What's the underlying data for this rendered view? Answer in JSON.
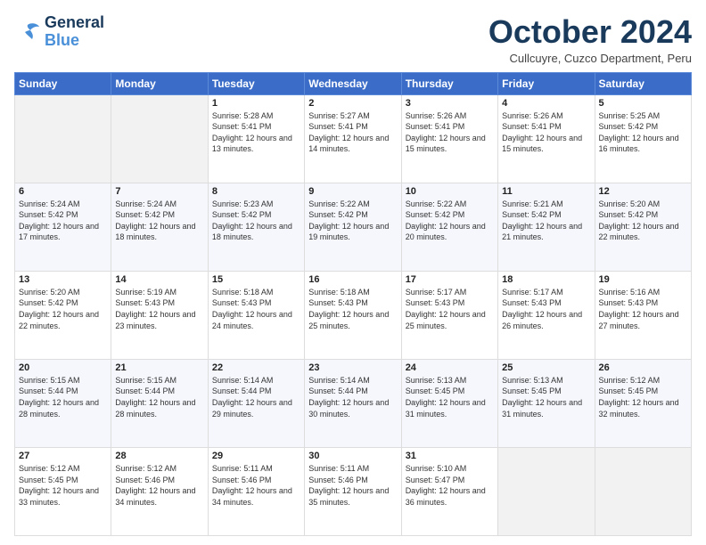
{
  "logo": {
    "line1": "General",
    "line2": "Blue"
  },
  "title": "October 2024",
  "location": "Cullcuyre, Cuzco Department, Peru",
  "days_header": [
    "Sunday",
    "Monday",
    "Tuesday",
    "Wednesday",
    "Thursday",
    "Friday",
    "Saturday"
  ],
  "weeks": [
    [
      {
        "day": "",
        "info": ""
      },
      {
        "day": "",
        "info": ""
      },
      {
        "day": "1",
        "info": "Sunrise: 5:28 AM\nSunset: 5:41 PM\nDaylight: 12 hours and 13 minutes."
      },
      {
        "day": "2",
        "info": "Sunrise: 5:27 AM\nSunset: 5:41 PM\nDaylight: 12 hours and 14 minutes."
      },
      {
        "day": "3",
        "info": "Sunrise: 5:26 AM\nSunset: 5:41 PM\nDaylight: 12 hours and 15 minutes."
      },
      {
        "day": "4",
        "info": "Sunrise: 5:26 AM\nSunset: 5:41 PM\nDaylight: 12 hours and 15 minutes."
      },
      {
        "day": "5",
        "info": "Sunrise: 5:25 AM\nSunset: 5:42 PM\nDaylight: 12 hours and 16 minutes."
      }
    ],
    [
      {
        "day": "6",
        "info": "Sunrise: 5:24 AM\nSunset: 5:42 PM\nDaylight: 12 hours and 17 minutes."
      },
      {
        "day": "7",
        "info": "Sunrise: 5:24 AM\nSunset: 5:42 PM\nDaylight: 12 hours and 18 minutes."
      },
      {
        "day": "8",
        "info": "Sunrise: 5:23 AM\nSunset: 5:42 PM\nDaylight: 12 hours and 18 minutes."
      },
      {
        "day": "9",
        "info": "Sunrise: 5:22 AM\nSunset: 5:42 PM\nDaylight: 12 hours and 19 minutes."
      },
      {
        "day": "10",
        "info": "Sunrise: 5:22 AM\nSunset: 5:42 PM\nDaylight: 12 hours and 20 minutes."
      },
      {
        "day": "11",
        "info": "Sunrise: 5:21 AM\nSunset: 5:42 PM\nDaylight: 12 hours and 21 minutes."
      },
      {
        "day": "12",
        "info": "Sunrise: 5:20 AM\nSunset: 5:42 PM\nDaylight: 12 hours and 22 minutes."
      }
    ],
    [
      {
        "day": "13",
        "info": "Sunrise: 5:20 AM\nSunset: 5:42 PM\nDaylight: 12 hours and 22 minutes."
      },
      {
        "day": "14",
        "info": "Sunrise: 5:19 AM\nSunset: 5:43 PM\nDaylight: 12 hours and 23 minutes."
      },
      {
        "day": "15",
        "info": "Sunrise: 5:18 AM\nSunset: 5:43 PM\nDaylight: 12 hours and 24 minutes."
      },
      {
        "day": "16",
        "info": "Sunrise: 5:18 AM\nSunset: 5:43 PM\nDaylight: 12 hours and 25 minutes."
      },
      {
        "day": "17",
        "info": "Sunrise: 5:17 AM\nSunset: 5:43 PM\nDaylight: 12 hours and 25 minutes."
      },
      {
        "day": "18",
        "info": "Sunrise: 5:17 AM\nSunset: 5:43 PM\nDaylight: 12 hours and 26 minutes."
      },
      {
        "day": "19",
        "info": "Sunrise: 5:16 AM\nSunset: 5:43 PM\nDaylight: 12 hours and 27 minutes."
      }
    ],
    [
      {
        "day": "20",
        "info": "Sunrise: 5:15 AM\nSunset: 5:44 PM\nDaylight: 12 hours and 28 minutes."
      },
      {
        "day": "21",
        "info": "Sunrise: 5:15 AM\nSunset: 5:44 PM\nDaylight: 12 hours and 28 minutes."
      },
      {
        "day": "22",
        "info": "Sunrise: 5:14 AM\nSunset: 5:44 PM\nDaylight: 12 hours and 29 minutes."
      },
      {
        "day": "23",
        "info": "Sunrise: 5:14 AM\nSunset: 5:44 PM\nDaylight: 12 hours and 30 minutes."
      },
      {
        "day": "24",
        "info": "Sunrise: 5:13 AM\nSunset: 5:45 PM\nDaylight: 12 hours and 31 minutes."
      },
      {
        "day": "25",
        "info": "Sunrise: 5:13 AM\nSunset: 5:45 PM\nDaylight: 12 hours and 31 minutes."
      },
      {
        "day": "26",
        "info": "Sunrise: 5:12 AM\nSunset: 5:45 PM\nDaylight: 12 hours and 32 minutes."
      }
    ],
    [
      {
        "day": "27",
        "info": "Sunrise: 5:12 AM\nSunset: 5:45 PM\nDaylight: 12 hours and 33 minutes."
      },
      {
        "day": "28",
        "info": "Sunrise: 5:12 AM\nSunset: 5:46 PM\nDaylight: 12 hours and 34 minutes."
      },
      {
        "day": "29",
        "info": "Sunrise: 5:11 AM\nSunset: 5:46 PM\nDaylight: 12 hours and 34 minutes."
      },
      {
        "day": "30",
        "info": "Sunrise: 5:11 AM\nSunset: 5:46 PM\nDaylight: 12 hours and 35 minutes."
      },
      {
        "day": "31",
        "info": "Sunrise: 5:10 AM\nSunset: 5:47 PM\nDaylight: 12 hours and 36 minutes."
      },
      {
        "day": "",
        "info": ""
      },
      {
        "day": "",
        "info": ""
      }
    ]
  ]
}
